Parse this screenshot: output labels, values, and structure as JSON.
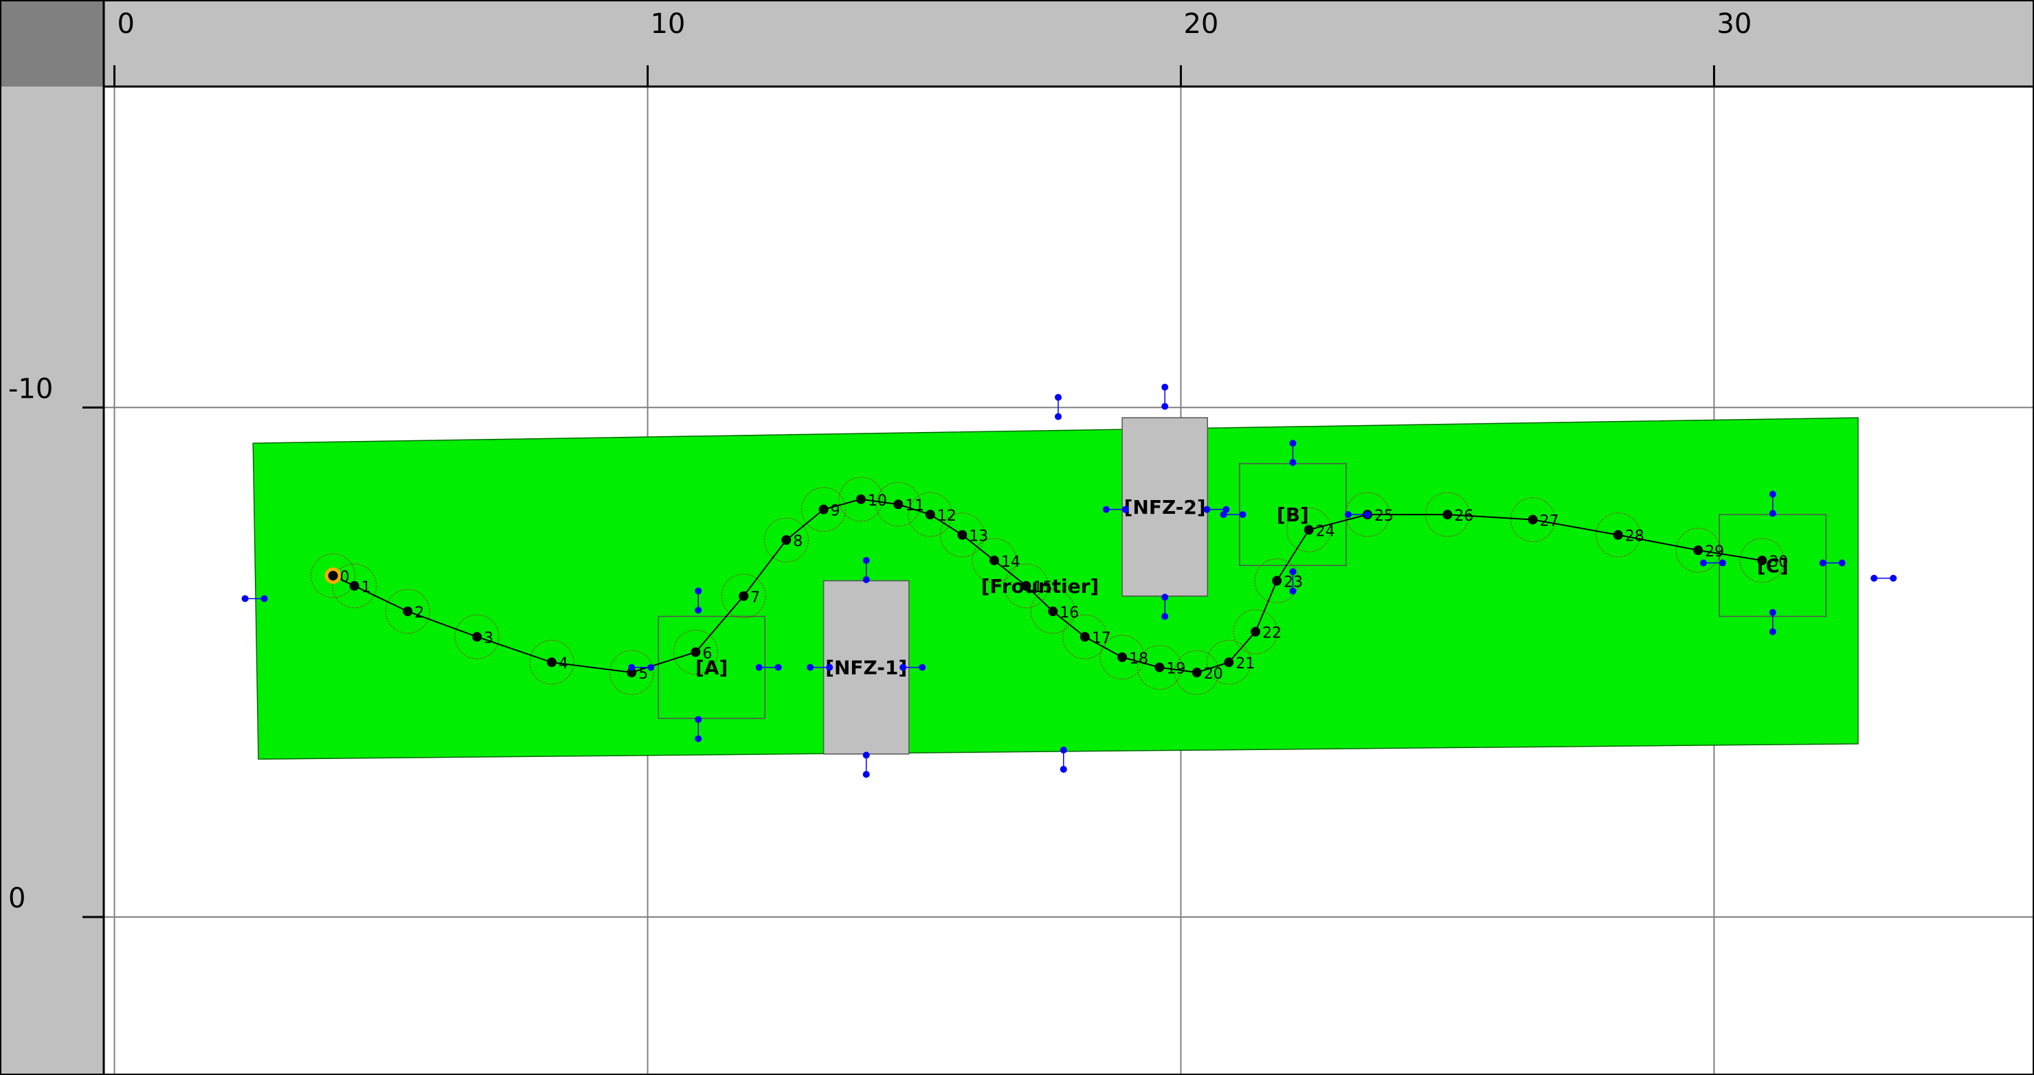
{
  "colors": {
    "ruler": "#c0c0c0",
    "corner": "#808080",
    "field": "#00ee00",
    "obstacle": "#c0c0c0",
    "waypoint": "#000000",
    "handle": "#0000ff",
    "footprint": "#cc0000",
    "start": "#ffaa00"
  },
  "view": {
    "x_min": -0.2,
    "x_max": 36.0,
    "y_min": -16.3,
    "y_max": 3.1
  },
  "rulers": {
    "x_ticks": [
      0,
      10,
      20,
      30
    ],
    "x_tick_labels": [
      "0",
      "10",
      "20",
      "30"
    ],
    "y_ticks": [
      -10,
      0
    ],
    "y_tick_labels": [
      "-10",
      "0"
    ]
  },
  "field": {
    "name": "field-area",
    "corners": [
      [
        2.6,
        -9.3
      ],
      [
        32.7,
        -9.8
      ],
      [
        32.7,
        -3.4
      ],
      [
        2.7,
        -3.1
      ]
    ]
  },
  "regions": [
    {
      "label": "[NFZ-1]",
      "type": "obstacle",
      "x": [
        13.3,
        14.9
      ],
      "y": [
        -6.6,
        -3.2
      ]
    },
    {
      "label": "[NFZ-2]",
      "type": "obstacle",
      "x": [
        18.9,
        20.5
      ],
      "y": [
        -9.8,
        -6.3
      ]
    },
    {
      "label": "[A]",
      "type": "zone",
      "x": [
        10.2,
        12.2
      ],
      "y": [
        -5.9,
        -3.9
      ]
    },
    {
      "label": "[B]",
      "type": "zone",
      "x": [
        21.1,
        23.1
      ],
      "y": [
        -8.9,
        -6.9
      ]
    },
    {
      "label": "[C]",
      "type": "zone",
      "x": [
        30.1,
        32.1
      ],
      "y": [
        -7.9,
        -5.9
      ]
    }
  ],
  "frontier_label": "[Frountier]",
  "path": [
    {
      "label": "0",
      "x": 4.1,
      "y": -6.7
    },
    {
      "label": "1",
      "x": 4.5,
      "y": -6.5
    },
    {
      "label": "2",
      "x": 5.5,
      "y": -6.0
    },
    {
      "label": "3",
      "x": 6.8,
      "y": -5.5
    },
    {
      "label": "4",
      "x": 8.2,
      "y": -5.0
    },
    {
      "label": "5",
      "x": 9.7,
      "y": -4.8
    },
    {
      "label": "6",
      "x": 10.9,
      "y": -5.2
    },
    {
      "label": "7",
      "x": 11.8,
      "y": -6.3
    },
    {
      "label": "8",
      "x": 12.6,
      "y": -7.4
    },
    {
      "label": "9",
      "x": 13.3,
      "y": -8.0
    },
    {
      "label": "10",
      "x": 14.0,
      "y": -8.2
    },
    {
      "label": "11",
      "x": 14.7,
      "y": -8.1
    },
    {
      "label": "12",
      "x": 15.3,
      "y": -7.9
    },
    {
      "label": "13",
      "x": 15.9,
      "y": -7.5
    },
    {
      "label": "14",
      "x": 16.5,
      "y": -7.0
    },
    {
      "label": "15",
      "x": 17.1,
      "y": -6.5
    },
    {
      "label": "16",
      "x": 17.6,
      "y": -6.0
    },
    {
      "label": "17",
      "x": 18.2,
      "y": -5.5
    },
    {
      "label": "18",
      "x": 18.9,
      "y": -5.1
    },
    {
      "label": "19",
      "x": 19.6,
      "y": -4.9
    },
    {
      "label": "20",
      "x": 20.3,
      "y": -4.8
    },
    {
      "label": "21",
      "x": 20.9,
      "y": -5.0
    },
    {
      "label": "22",
      "x": 21.4,
      "y": -5.6
    },
    {
      "label": "23",
      "x": 21.8,
      "y": -6.6
    },
    {
      "label": "24",
      "x": 22.4,
      "y": -7.6
    },
    {
      "label": "25",
      "x": 23.5,
      "y": -7.9
    },
    {
      "label": "26",
      "x": 25.0,
      "y": -7.9
    },
    {
      "label": "27",
      "x": 26.6,
      "y": -7.8
    },
    {
      "label": "28",
      "x": 28.2,
      "y": -7.5
    },
    {
      "label": "29",
      "x": 29.7,
      "y": -7.2
    },
    {
      "label": "30",
      "x": 30.9,
      "y": -7.0
    }
  ],
  "handles": [
    {
      "x": 2.45,
      "y": -6.25,
      "dx": 1,
      "dy": 0
    },
    {
      "x": 10.95,
      "y": -6.4,
      "dx": 0,
      "dy": 1
    },
    {
      "x": 10.95,
      "y": -3.5,
      "dx": 0,
      "dy": -1
    },
    {
      "x": 9.7,
      "y": -4.9,
      "dx": 1,
      "dy": 0
    },
    {
      "x": 12.45,
      "y": -4.9,
      "dx": -1,
      "dy": 0
    },
    {
      "x": 14.1,
      "y": -7.0,
      "dx": 0,
      "dy": 1
    },
    {
      "x": 14.1,
      "y": -2.8,
      "dx": 0,
      "dy": -1
    },
    {
      "x": 13.05,
      "y": -4.9,
      "dx": 1,
      "dy": 0
    },
    {
      "x": 15.15,
      "y": -4.9,
      "dx": -1,
      "dy": 0
    },
    {
      "x": 17.7,
      "y": -10.2,
      "dx": 0,
      "dy": 1
    },
    {
      "x": 17.8,
      "y": -2.9,
      "dx": 0,
      "dy": -1
    },
    {
      "x": 19.7,
      "y": -10.4,
      "dx": 0,
      "dy": 1
    },
    {
      "x": 19.7,
      "y": -5.9,
      "dx": 0,
      "dy": -1
    },
    {
      "x": 18.6,
      "y": -8.0,
      "dx": 1,
      "dy": 0
    },
    {
      "x": 20.85,
      "y": -8.0,
      "dx": -1,
      "dy": 0
    },
    {
      "x": 22.1,
      "y": -9.3,
      "dx": 0,
      "dy": 1
    },
    {
      "x": 22.1,
      "y": -6.4,
      "dx": 0,
      "dy": -1
    },
    {
      "x": 20.8,
      "y": -7.9,
      "dx": 1,
      "dy": 0
    },
    {
      "x": 23.5,
      "y": -7.9,
      "dx": -1,
      "dy": 0
    },
    {
      "x": 31.1,
      "y": -8.3,
      "dx": 0,
      "dy": 1
    },
    {
      "x": 31.1,
      "y": -5.6,
      "dx": 0,
      "dy": -1
    },
    {
      "x": 29.8,
      "y": -6.95,
      "dx": 1,
      "dy": 0
    },
    {
      "x": 32.4,
      "y": -6.95,
      "dx": -1,
      "dy": 0
    },
    {
      "x": 33.0,
      "y": -6.65,
      "dx": 1,
      "dy": 0
    }
  ]
}
